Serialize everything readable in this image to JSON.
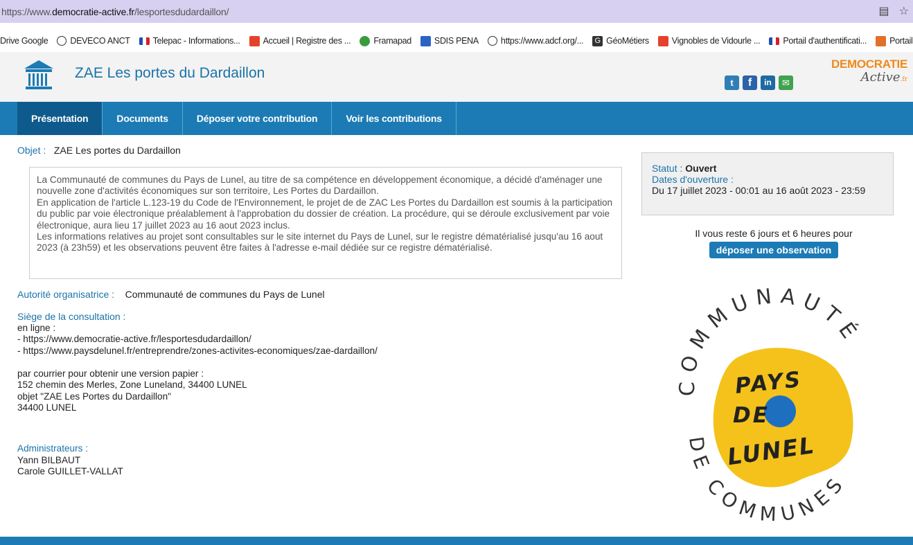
{
  "browser": {
    "url_prefix": "https://www.",
    "url_domain": "democratie-active.fr",
    "url_path": "/lesportesdudardaillon/",
    "bookmarks": [
      {
        "label": "Drive Google",
        "icon": "none"
      },
      {
        "label": "DEVECO ANCT",
        "icon": "globe"
      },
      {
        "label": "Telepac - Informations...",
        "icon": "flag"
      },
      {
        "label": "Accueil | Registre des ...",
        "icon": "red"
      },
      {
        "label": "Framapad",
        "icon": "green"
      },
      {
        "label": "SDIS PENA",
        "icon": "blue"
      },
      {
        "label": "https://www.adcf.org/...",
        "icon": "globe"
      },
      {
        "label": "GéoMétiers",
        "icon": "dark"
      },
      {
        "label": "Vignobles de Vidourle ...",
        "icon": "red"
      },
      {
        "label": "Portail d'authentificati...",
        "icon": "flag"
      },
      {
        "label": "Portail A",
        "icon": "orange"
      }
    ]
  },
  "header": {
    "title": "ZAE Les portes du Dardaillon",
    "brand_top": "DEMOCRATIE",
    "brand_bottom": "Active",
    "brand_suffix": ".fr"
  },
  "nav": {
    "items": [
      "Présentation",
      "Documents",
      "Déposer votre contribution",
      "Voir les contributions"
    ]
  },
  "main": {
    "objet_label": "Objet :",
    "objet_value": "ZAE Les portes du Dardaillon",
    "description": [
      "La Communauté de communes du Pays de Lunel, au titre de sa compétence en développement économique, a décidé d'aménager une nouvelle zone d'activités économiques sur son territoire, Les Portes du Dardaillon.",
      "En application de l'article L.123-19 du Code de l'Environnement, le projet de de ZAC Les Portes du Dardaillon est soumis à la participation du public par voie électronique préalablement à l'approbation du dossier de création. La procédure, qui se déroule exclusivement par voie électronique, aura lieu 17 juillet 2023 au 16 aout 2023 inclus.",
      "Les informations relatives au projet sont consultables sur le site internet du Pays de Lunel, sur le registre dématérialisé jusqu'au 16 aout 2023 (à 23h59) et les observations peuvent être faites à l'adresse e-mail dédiée sur ce registre dématérialisé."
    ],
    "autorite_label": "Autorité organisatrice :",
    "autorite_value": "Communauté de communes du Pays de Lunel",
    "siege_label": "Siège de la consultation :",
    "siege_lines": [
      "en ligne :",
      "- https://www.democratie-active.fr/lesportesdudardaillon/",
      "- https://www.paysdelunel.fr/entreprendre/zones-activites-economiques/zae-dardaillon/",
      "",
      "par courrier pour obtenir une version papier :",
      "152 chemin des Merles, Zone Luneland, 34400 LUNEL",
      "objet \"ZAE Les Portes du Dardaillon\"",
      "34400 LUNEL"
    ],
    "admins_label": "Administrateurs :",
    "admins": [
      "Yann BILBAUT",
      "Carole GUILLET-VALLAT"
    ]
  },
  "status": {
    "statut_label": "Statut :",
    "statut_value": "Ouvert",
    "dates_label": "Dates d'ouverture :",
    "dates_value": "Du 17 juillet 2023 - 00:01 au 16 août 2023 - 23:59",
    "remaining": "Il vous reste 6 jours et 6 heures pour",
    "deposit_button": "déposer une observation"
  },
  "logo": {
    "ring_top": "COMMUNAUTÉ",
    "ring_bottom": "DE COMMUNES",
    "center_line1": "PAYS",
    "center_line2": "DE",
    "center_line3": "LUNEL"
  },
  "colors": {
    "accent": "#1c7bb5",
    "link_label": "#1a73a8",
    "brand_orange": "#f0891c",
    "logo_yellow": "#f4c21b",
    "logo_blue": "#1f6fc0"
  }
}
